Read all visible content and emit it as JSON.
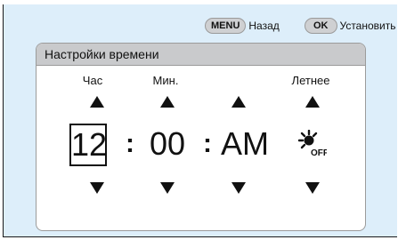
{
  "hints": {
    "menu_key": "MENU",
    "menu_label": "Назад",
    "ok_key": "OK",
    "ok_label": "Установить"
  },
  "panel": {
    "title": "Настройки времени",
    "columns": {
      "hour_label": "Час",
      "minute_label": "Мин.",
      "dst_label": "Летнее"
    },
    "values": {
      "hour": "12",
      "separator": ":",
      "minute": "00",
      "ampm": "AM",
      "dst_state": "OFF"
    }
  },
  "icons": {
    "dst": "sun-off-icon",
    "up": "arrow-up-icon",
    "down": "arrow-down-icon"
  }
}
